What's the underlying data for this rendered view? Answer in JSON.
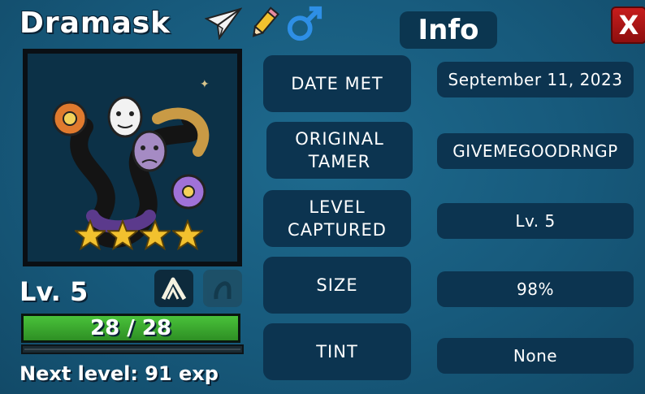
{
  "header": {
    "creature_name": "Dramask",
    "tab_label": "Info",
    "close_label": "X",
    "icons": [
      "paper-plane-icon",
      "pencil-icon",
      "male-symbol-icon"
    ]
  },
  "portrait": {
    "creature_art": "dramask-masks-creature",
    "star_rating": 4,
    "star_color": "#f2c12e"
  },
  "stats": {
    "level_text": "Lv. 5",
    "hp_text": "28 / 28",
    "hp_fraction": 1.0,
    "next_level_text": "Next level: 91 exp",
    "skill_icons": [
      "claw-skill-icon",
      "locked-skill-icon"
    ]
  },
  "info_rows": [
    {
      "label": "DATE MET",
      "value": "September 11, 2023"
    },
    {
      "label": "ORIGINAL TAMER",
      "value": "GIVEMEGOODRNGP"
    },
    {
      "label": "LEVEL CAPTURED",
      "value": "Lv. 5"
    },
    {
      "label": "SIZE",
      "value": "98%"
    },
    {
      "label": "TINT",
      "value": "None"
    }
  ],
  "colors": {
    "background": "#175a7c",
    "panel": "#0c3450",
    "hp_green": "#3ca830",
    "close_red": "#b51818",
    "male_blue": "#2e8fe6"
  }
}
